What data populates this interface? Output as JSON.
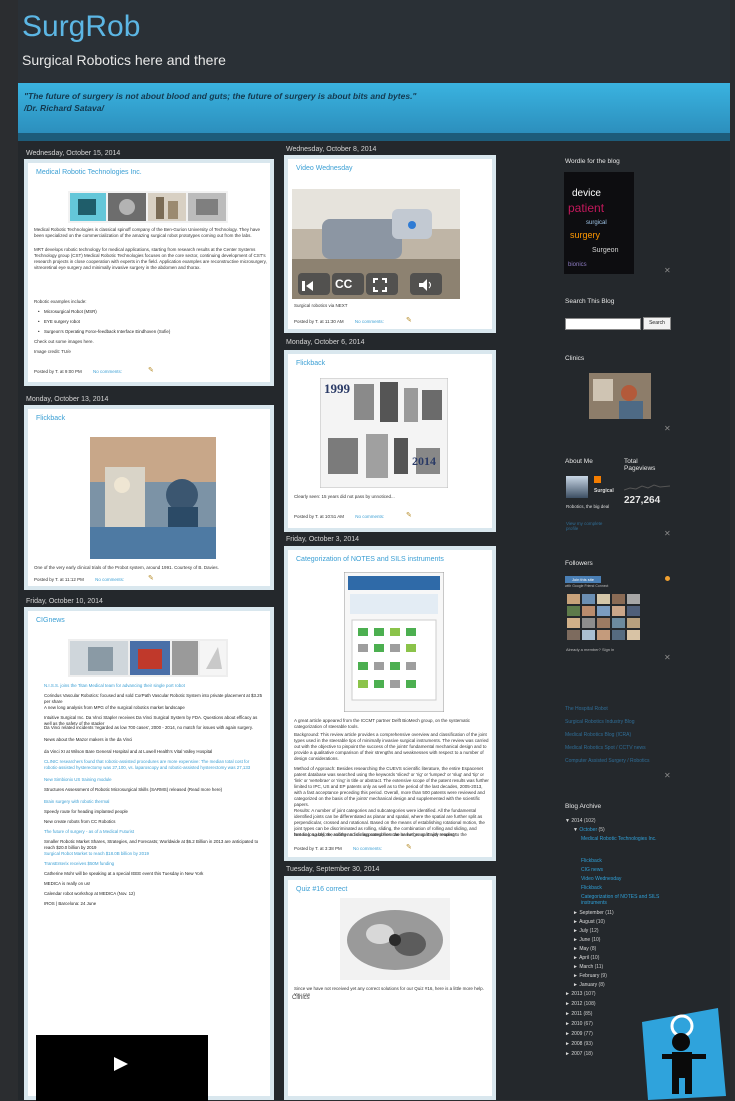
{
  "blog": {
    "title": "SurgRob",
    "subtitle": "Surgical Robotics here and there",
    "quote_line1": "\"The future of surgery is not about blood and guts; the future of surgery is about bits and bytes.\"",
    "quote_line2": "/Dr. Richard Satava/"
  },
  "left_col": {
    "date1": "Wednesday, October 15, 2014",
    "post1": {
      "title": "Medical Robotic Technologies Inc.",
      "body1": "Medical Robotic Technologies is classical spinoff company of the Ben-Gurion University of Technology. They have been specialized on the commercialization of the amazing surgical robot prototypes coming out from the labs.",
      "body2": "MRT develops robotic technology for medical applications, starting from research results at the Center Systems Technology group (CST) Medical Robotic Technologies focuses on the core sector, continuing development of CST's research projects in close cooperation with experts in the field. Application examples are reconstructive microsurgery, vitreoretinal eye surgery and minimally invasive surgery in the abdomen and thorax.",
      "examples_label": "Robotic examples include:",
      "bullets": [
        "Microsurgical Robot (MSR)",
        "EYE surgery robot",
        "Surgeon's Operating Force-feedback Interface Eindhoven (Sofie)"
      ],
      "more": "Check out some images here.",
      "credit": "Image credit: TU/e",
      "posted_by": "Posted by T. at 9:00 PM",
      "comments": "No comments:"
    },
    "date2": "Monday, October 13, 2014",
    "post2": {
      "title": "Flickback",
      "caption": "One of the very early clinical trials of the Probot system, around 1991. Courtesy of B. Davies.",
      "posted_by": "Posted by T. at 11:12 PM",
      "comments": "No comments:"
    },
    "date3": "Friday, October 10, 2014",
    "post3": {
      "title": "CIGnews",
      "items": [
        {
          "t": "N.I.S.S. joins the Titan Medical team for advancing their single port robot",
          "l": true
        },
        {
          "t": "Corindus Vascular Robotics: focused and sold CorPath Vascular Robotic System into private placement at $3.25 per share",
          "l": false
        },
        {
          "t": "A new long analysis from MPG of the surgical robotics market landscape",
          "l": false
        },
        {
          "t": "Intuitive Surgical Inc. Da Vinci Stapler receives Da Vinci Surgical System by FDA. Questions about efficacy as well as the safety of the stapler",
          "l": false
        },
        {
          "t": "Da Vinci related incidents 'regarded as low 700 cases', 2000 - 2014, no match for issues with again surgery.",
          "l": false
        },
        {
          "t": "News about the Mazor makers in the da Vinci",
          "l": false
        },
        {
          "t": "da Vinci XI at Wilson Bare General Hospital and at Lowell Health's Vital Valley Hospital",
          "l": false
        },
        {
          "t": "CLINIC researchers found that robotic-assisted procedures are more expensive: The median total cost for robotic-assisted hysterectomy was 27,100, vs. laparoscopy and robotic-assisted hysterectomy was 27,133",
          "l": true
        },
        {
          "t": "New Simbionix US training module",
          "l": true
        },
        {
          "t": "Structures Assessment of Robotic Microsurgical Skills (SARMS) released (Read more here)",
          "l": false
        },
        {
          "t": "Brain surgery with robotic thermal",
          "l": true
        },
        {
          "t": "Speedy route for heading implanted people",
          "l": false
        },
        {
          "t": "New create robots from CC Robotics",
          "l": false
        },
        {
          "t": "The future of surgery - as of a Medical Futurist",
          "l": true
        },
        {
          "t": "Smaller Robotic Market Shares, Strategies, and Forecasts; Worldwide at $6.2 Billion in 2013 are anticipated to reach $20.0 billion by 2019",
          "l": false
        },
        {
          "t": "Surgical Robot Market to reach $18.0B billion by 2019",
          "l": true
        },
        {
          "t": "TransEnterix receives $50M funding",
          "l": true
        },
        {
          "t": "Catherine Mohr will be speaking at a special IEEE event this Tuesday in New York",
          "l": false
        },
        {
          "t": "MEDICA is really on us!",
          "l": false
        },
        {
          "t": "Calendar robot workshop at MEDICA (Nov. 12)",
          "l": false
        },
        {
          "t": "IROS | Barcelona: 24 June",
          "l": false
        }
      ]
    }
  },
  "mid_col": {
    "date1": "Wednesday, October 8, 2014",
    "post1": {
      "title": "Video Wednesday",
      "cc": "CC",
      "caption": "Surgical robotics via NEXT",
      "posted_by": "Posted by T. at 11:30 AM",
      "comments": "No comments:"
    },
    "date2": "Monday, October 6, 2014",
    "post2": {
      "title": "Flickback",
      "year1": "1999",
      "year2": "2014",
      "caption": "Clearly seen: 15 years did not pass by unnoticed...",
      "posted_by": "Posted by T. at 10:51 AM",
      "comments": "No comments:"
    },
    "date3": "Friday, October 3, 2014",
    "post3": {
      "title": "Categorization of NOTES and SILS instruments",
      "lead": "A great article appeared from the ICCMT partner Delft BioMech group, on the systematic categorization of steerable tools.",
      "p1": "Background: This review article provides a comprehensive overview and classification of the joint types used in the steerable tips of minimally invasive surgical instruments. The review was carried out with the objective to pinpoint the success of the joints' fundamental mechanical design and to provide a qualitative comparison of their strengths and weaknesses with respect to a number of design considerations.",
      "p2": "Method of Approach: Besides researching the CUEVS scientific literature, the entire Espacenet patent database was searched using the keywords 'sliced' or 'rig' or 'lumped' or 'slug' and 'tip' or 'link' or 'vertebrae' or 'ring' in title or abstract. The extensive scope of the patent results was further limited to IPC, US and EP patents only as well as to the period of the last decades, 2005-2013, with a fast acceptance preceding this period. Overall, more than 500 patents were reviewed and categorized on the basis of the joints' mechanical design and supplemented with the scientific papers.",
      "p3": "Results: A number of joint categories and subcategories were identified. All the fundamental identified joints can be differentiated as planar and spatial, where the spatial are further split as perpendicular, crossed and rotational. Based on the means of establishing rotational motion, the joint types can be discriminated as rolling, sliding, the combination of rolling and sliding, and bending. Lastly, the rolling and sliding categories can be further split with respect to the phenomenon or feature used for transferring the rotational motion, i.e. friction, teeth, balls, curved features and hinges.",
      "p4": "Conclusion: In general, the most frequent joint types were identified as sliding hinged joints sliding curved rotational joints and the bending joint category overall. Nevertheless, it was recognized that no single fundamental joint type can be considered as ideal and that novel and preferably more superior joint configurations can be generated by combining several fundamental categories together.",
      "keywords": "Keywords: minimally invasive surgery, steerable tip, mechanical joint design, classification, review",
      "outro": "Not so long before, another article appeared from the same group. Enjoy reading!",
      "posted_by": "Posted by T. at 3:38 PM",
      "comments": "No comments:"
    },
    "date4": "Tuesday, September 30, 2014",
    "post4": {
      "title": "Quiz #16 correct",
      "caption": "Since we have not received yet any correct solutions for our Quiz #16, here is a little more help. You can",
      "footer_label": "Clinics"
    }
  },
  "sidebar": {
    "wordle_title": "Wordle for the blog",
    "wordle_words": [
      "device",
      "patient",
      "surgical",
      "surgery",
      "Surgeon",
      "bionics"
    ],
    "search_title": "Search This Blog",
    "search_button": "Search",
    "clinics_title": "Clinics",
    "about_title": "About Me",
    "about_name": "Surgical",
    "about_desc": "Robotics, the big deal",
    "about_link": "View my complete profile",
    "pageviews_title": "Total Pageviews",
    "pageviews": "227,264",
    "followers_title": "Followers",
    "follow_label": "Join this site",
    "follow_sub": "with Google Friend Connect",
    "members": "Already a member? Sign in",
    "links": [
      "The Hospital Robot",
      "Surgical Robotics Industry Blog",
      "Medical Robotics Blog (ICRA)",
      "Medical Robotics Spot / CCTV news",
      "Computer Assisted Surgery / Robotics"
    ],
    "archive_title": "Blog Archive",
    "archive": [
      {
        "label": "2014",
        "count": "(102)",
        "indent": 0,
        "open": true
      },
      {
        "label": "October",
        "count": "(5)",
        "indent": 1,
        "open": true
      },
      {
        "label": "Medical Robotic Technologies Inc.",
        "count": "",
        "indent": 2,
        "open": false,
        "link": true
      },
      {
        "label": "Flickback",
        "count": "",
        "indent": 2,
        "open": false,
        "link": true
      },
      {
        "label": "CIG news",
        "count": "",
        "indent": 2,
        "open": false,
        "link": true
      },
      {
        "label": "Video Wednesday",
        "count": "",
        "indent": 2,
        "open": false,
        "link": true
      },
      {
        "label": "Flickback",
        "count": "",
        "indent": 2,
        "open": false,
        "link": true
      },
      {
        "label": "Categorization of NOTES and SILS instruments",
        "count": "",
        "indent": 2,
        "open": false,
        "link": true
      },
      {
        "label": "September",
        "count": "(11)",
        "indent": 1,
        "open": false
      },
      {
        "label": "August",
        "count": "(10)",
        "indent": 1,
        "open": false
      },
      {
        "label": "July",
        "count": "(12)",
        "indent": 1,
        "open": false
      },
      {
        "label": "June",
        "count": "(10)",
        "indent": 1,
        "open": false
      },
      {
        "label": "May",
        "count": "(8)",
        "indent": 1,
        "open": false
      },
      {
        "label": "April",
        "count": "(10)",
        "indent": 1,
        "open": false
      },
      {
        "label": "March",
        "count": "(11)",
        "indent": 1,
        "open": false
      },
      {
        "label": "February",
        "count": "(9)",
        "indent": 1,
        "open": false
      },
      {
        "label": "January",
        "count": "(8)",
        "indent": 1,
        "open": false
      },
      {
        "label": "2013",
        "count": "(107)",
        "indent": 0,
        "open": false
      },
      {
        "label": "2012",
        "count": "(108)",
        "indent": 0,
        "open": false
      },
      {
        "label": "2011",
        "count": "(85)",
        "indent": 0,
        "open": false
      },
      {
        "label": "2010",
        "count": "(67)",
        "indent": 0,
        "open": false
      },
      {
        "label": "2009",
        "count": "(77)",
        "indent": 0,
        "open": false
      },
      {
        "label": "2008",
        "count": "(93)",
        "indent": 0,
        "open": false
      },
      {
        "label": "2007",
        "count": "(18)",
        "indent": 0,
        "open": false
      }
    ]
  },
  "colors": {
    "accent": "#3b9fd4",
    "background": "#24282c",
    "header": "#2a3036",
    "quote_band": "#3ab3e0"
  }
}
